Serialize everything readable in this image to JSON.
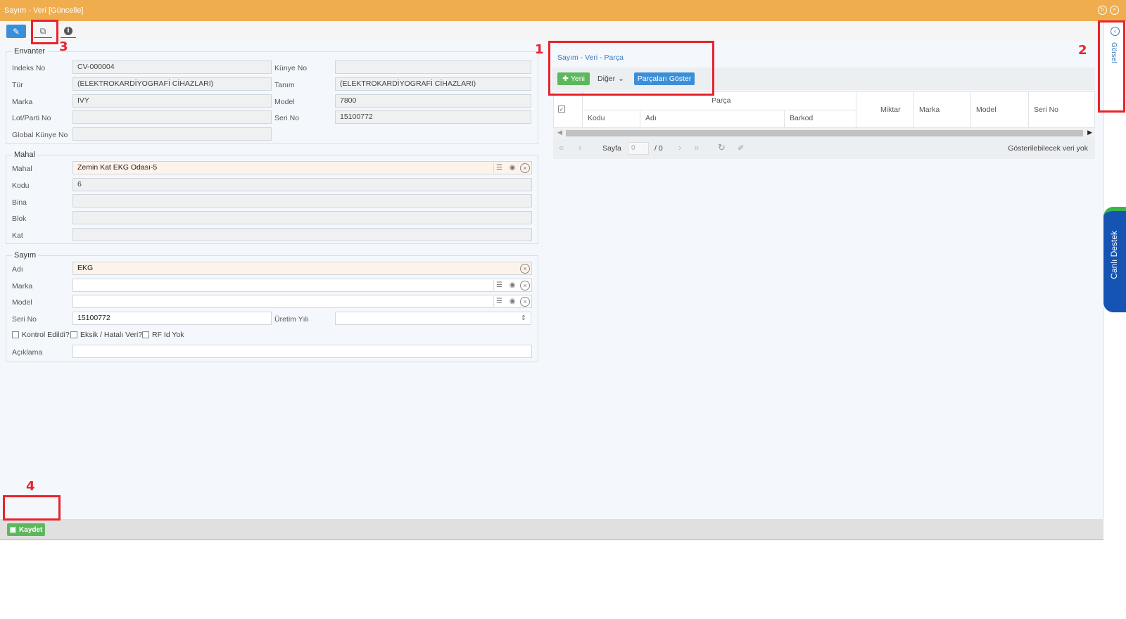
{
  "window": {
    "title": "Sayım - Veri [Güncelle]"
  },
  "toolbar": {
    "edit_icon": "edit-icon",
    "copy_icon": "copy-icon",
    "info_icon": "info-icon",
    "info_glyph": "i"
  },
  "envanter": {
    "legend": "Envanter",
    "indeks_label": "Indeks No",
    "indeks_value": "CV-000004",
    "kunye_label": "Künye No",
    "kunye_value": "",
    "tur_label": "Tür",
    "tur_value": "(ELEKTROKARDİYOGRAFİ CİHAZLARI)",
    "tanim_label": "Tanım",
    "tanim_value": "(ELEKTROKARDİYOGRAFİ CİHAZLARI)",
    "marka_label": "Marka",
    "marka_value": "IVY",
    "model_label": "Model",
    "model_value": "7800",
    "lot_label": "Lot/Parti No",
    "lot_value": "",
    "seri_label": "Seri No",
    "seri_value": "15100772",
    "global_label": "Global Künye No",
    "global_value": ""
  },
  "mahal": {
    "legend": "Mahal",
    "mahal_label": "Mahal",
    "mahal_value": "Zemin Kat EKG  Odası-5",
    "kodu_label": "Kodu",
    "kodu_value": "6",
    "bina_label": "Bina",
    "bina_value": "",
    "blok_label": "Blok",
    "blok_value": "",
    "kat_label": "Kat",
    "kat_value": ""
  },
  "sayim": {
    "legend": "Sayım",
    "adi_label": "Adı",
    "adi_value": "EKG",
    "marka_label": "Marka",
    "marka_value": "",
    "model_label": "Model",
    "model_value": "",
    "seri_label": "Seri No",
    "seri_value": "15100772",
    "uretim_label": "Üretim Yılı",
    "uretim_value": "",
    "kontrol_label": "Kontrol Edildi?",
    "eksik_label": "Eksik / Hatalı Veri?",
    "rfid_label": "RF Id Yok",
    "aciklama_label": "Açıklama",
    "aciklama_value": ""
  },
  "parca": {
    "title": "Sayım - Veri - Parça",
    "yeni_label": "Yeni",
    "diger_label": "Diğer",
    "goster_label": "Parçaları Göster",
    "group_header": "Parça",
    "columns": [
      "Kodu",
      "Adı",
      "Barkod",
      "Miktar",
      "Marka",
      "Model",
      "Seri No"
    ],
    "pager": {
      "sayfa_label": "Sayfa",
      "page_value": "0",
      "total": "/ 0",
      "empty_text": "Gösterilebilecek veri yok"
    }
  },
  "footer": {
    "save_label": "Kaydet"
  },
  "side": {
    "gorsel_label": "Görsel",
    "canli_label": "Canlı Destek"
  },
  "annotations": [
    "1",
    "2",
    "3",
    "4"
  ],
  "colors": {
    "title_bar": "#f0ad4e",
    "primary": "#3b8fd9",
    "success": "#5cb85c",
    "highlight": "#e8232b",
    "support": "#1554b3"
  }
}
